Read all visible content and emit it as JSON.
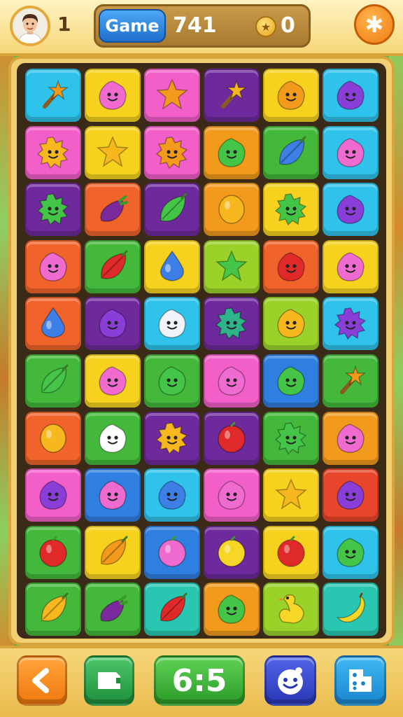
{
  "topbar": {
    "level": "1",
    "mode_label": "Game",
    "score": "741",
    "coins": "0"
  },
  "icons": {
    "settings": "gear-icon",
    "coin": "coin-icon",
    "back": "chevron-left-icon",
    "card": "card-icon",
    "face": "smiley-face-icon",
    "dice": "dice-icon"
  },
  "bottombar": {
    "timer": "6:5"
  },
  "colors": {
    "tiles": {
      "cyan": "#2fc3ec",
      "yellow": "#f6d21f",
      "pink": "#f25fc9",
      "purple": "#6e2a9c",
      "orange": "#f29a1c",
      "green": "#43b83a",
      "lime": "#9ad22a",
      "red": "#e8452a",
      "blue": "#2f7fe0",
      "redorange": "#f0632a",
      "teal": "#29c7b2"
    },
    "pieces": {
      "orange": "#f39a1c",
      "gold": "#f7b81f",
      "pink": "#f06bd0",
      "green": "#45c548",
      "blue": "#3d7fe6",
      "purple": "#8a3ed8",
      "red": "#e02a2a",
      "yellow": "#f6d627",
      "white": "#f0f4fa",
      "eggplant": "#7a2a9c",
      "teal": "#2eb38a"
    }
  },
  "board": {
    "rows": [
      [
        {
          "bg": "cyan",
          "shape": "wand",
          "c": "orange"
        },
        {
          "bg": "yellow",
          "shape": "blob",
          "c": "pink"
        },
        {
          "bg": "pink",
          "shape": "star",
          "c": "orange"
        },
        {
          "bg": "purple",
          "shape": "wand",
          "c": "gold"
        },
        {
          "bg": "yellow",
          "shape": "blob",
          "c": "orange"
        },
        {
          "bg": "cyan",
          "shape": "blob",
          "c": "purple"
        }
      ],
      [
        {
          "bg": "pink",
          "shape": "sun",
          "c": "gold"
        },
        {
          "bg": "yellow",
          "shape": "star",
          "c": "gold"
        },
        {
          "bg": "pink",
          "shape": "sun",
          "c": "orange"
        },
        {
          "bg": "orange",
          "shape": "blob",
          "c": "green"
        },
        {
          "bg": "green",
          "shape": "leaf",
          "c": "blue"
        },
        {
          "bg": "cyan",
          "shape": "blob",
          "c": "pink"
        }
      ],
      [
        {
          "bg": "purple",
          "shape": "sun",
          "c": "green"
        },
        {
          "bg": "redorange",
          "shape": "eggplant",
          "c": "eggplant"
        },
        {
          "bg": "purple",
          "shape": "leaf",
          "c": "green"
        },
        {
          "bg": "orange",
          "shape": "lemon",
          "c": "gold"
        },
        {
          "bg": "yellow",
          "shape": "sun",
          "c": "green"
        },
        {
          "bg": "cyan",
          "shape": "blob",
          "c": "purple"
        }
      ],
      [
        {
          "bg": "redorange",
          "shape": "blob",
          "c": "pink"
        },
        {
          "bg": "green",
          "shape": "leaf",
          "c": "red"
        },
        {
          "bg": "yellow",
          "shape": "drop",
          "c": "blue"
        },
        {
          "bg": "lime",
          "shape": "star",
          "c": "green"
        },
        {
          "bg": "redorange",
          "shape": "blob",
          "c": "red"
        },
        {
          "bg": "yellow",
          "shape": "blob",
          "c": "pink"
        }
      ],
      [
        {
          "bg": "redorange",
          "shape": "drop",
          "c": "blue"
        },
        {
          "bg": "purple",
          "shape": "blob",
          "c": "purple"
        },
        {
          "bg": "cyan",
          "shape": "blob",
          "c": "white"
        },
        {
          "bg": "purple",
          "shape": "sun",
          "c": "teal"
        },
        {
          "bg": "lime",
          "shape": "blob",
          "c": "gold"
        },
        {
          "bg": "cyan",
          "shape": "sun",
          "c": "purple"
        }
      ],
      [
        {
          "bg": "green",
          "shape": "leaf",
          "c": "green"
        },
        {
          "bg": "yellow",
          "shape": "blob",
          "c": "pink"
        },
        {
          "bg": "green",
          "shape": "blob",
          "c": "green"
        },
        {
          "bg": "pink",
          "shape": "blob",
          "c": "pink"
        },
        {
          "bg": "blue",
          "shape": "blob",
          "c": "green"
        },
        {
          "bg": "green",
          "shape": "wand",
          "c": "orange"
        }
      ],
      [
        {
          "bg": "redorange",
          "shape": "lemon",
          "c": "gold"
        },
        {
          "bg": "green",
          "shape": "blob",
          "c": "lime"
        },
        {
          "bg": "purple",
          "shape": "sun",
          "c": "gold"
        },
        {
          "bg": "purple",
          "shape": "circle",
          "c": "red"
        },
        {
          "bg": "green",
          "shape": "sun",
          "c": "green"
        },
        {
          "bg": "orange",
          "shape": "blob",
          "c": "pink"
        }
      ],
      [
        {
          "bg": "pink",
          "shape": "blob",
          "c": "purple"
        },
        {
          "bg": "blue",
          "shape": "blob",
          "c": "pink"
        },
        {
          "bg": "cyan",
          "shape": "blob",
          "c": "blue"
        },
        {
          "bg": "pink",
          "shape": "blob",
          "c": "pink"
        },
        {
          "bg": "yellow",
          "shape": "star",
          "c": "gold"
        },
        {
          "bg": "red",
          "shape": "blob",
          "c": "purple"
        }
      ],
      [
        {
          "bg": "green",
          "shape": "circle",
          "c": "red"
        },
        {
          "bg": "yellow",
          "shape": "leaf",
          "c": "orange"
        },
        {
          "bg": "blue",
          "shape": "circle",
          "c": "pink"
        },
        {
          "bg": "purple",
          "shape": "circle",
          "c": "yellow"
        },
        {
          "bg": "yellow",
          "shape": "circle",
          "c": "red"
        },
        {
          "bg": "cyan",
          "shape": "blob",
          "c": "green"
        }
      ],
      [
        {
          "bg": "green",
          "shape": "leaf",
          "c": "gold"
        },
        {
          "bg": "green",
          "shape": "eggplant",
          "c": "eggplant"
        },
        {
          "bg": "teal",
          "shape": "leaf",
          "c": "red"
        },
        {
          "bg": "orange",
          "shape": "blob",
          "c": "green"
        },
        {
          "bg": "lime",
          "shape": "duck",
          "c": "yellow"
        },
        {
          "bg": "teal",
          "shape": "banana",
          "c": "yellow"
        }
      ]
    ]
  }
}
